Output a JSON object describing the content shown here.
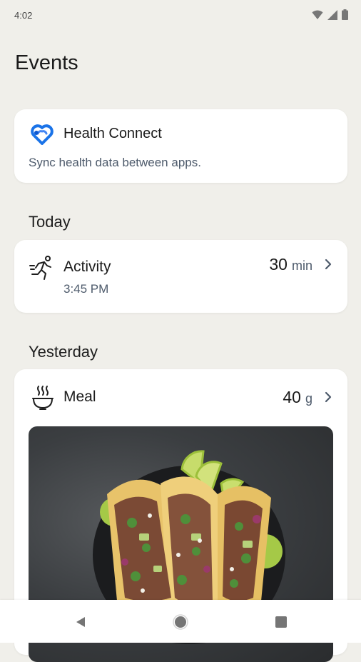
{
  "status": {
    "time": "4:02",
    "icons": [
      "wifi-icon",
      "cellular-signal-icon",
      "battery-icon"
    ]
  },
  "page": {
    "title": "Events"
  },
  "health_connect": {
    "name": "Health Connect",
    "description": "Sync health data between apps.",
    "logo_colors": [
      "#1a73e8",
      "#4285f4"
    ]
  },
  "sections": {
    "today": {
      "label": "Today",
      "activity": {
        "name": "Activity",
        "time": "3:45 PM",
        "value": "30",
        "unit": "min",
        "icon": "running-person-icon"
      }
    },
    "yesterday": {
      "label": "Yesterday",
      "meal": {
        "name": "Meal",
        "value": "40",
        "unit": "g",
        "icon": "meal-bowl-icon",
        "photo": "tacos-photo"
      }
    }
  },
  "nav": {
    "icons": [
      "back-icon",
      "home-icon",
      "recents-icon"
    ]
  }
}
